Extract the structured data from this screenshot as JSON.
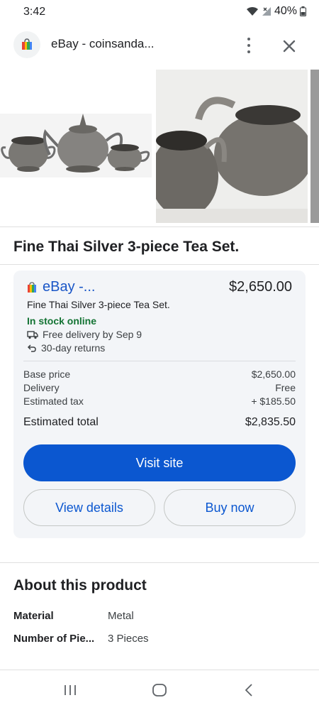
{
  "status_bar": {
    "time": "3:42",
    "battery": "40%"
  },
  "browser": {
    "title": "eBay - coinsanda..."
  },
  "product": {
    "title": "Fine Thai Silver 3-piece Tea Set."
  },
  "offer": {
    "seller": "eBay -...",
    "price": "$2,650.00",
    "description": "Fine Thai Silver 3-piece Tea Set.",
    "stock": "In stock online",
    "delivery": "Free delivery by Sep 9",
    "returns": "30-day returns",
    "breakdown": {
      "base_label": "Base price",
      "base_value": "$2,650.00",
      "delivery_label": "Delivery",
      "delivery_value": "Free",
      "tax_label": "Estimated tax",
      "tax_value": "+ $185.50",
      "total_label": "Estimated total",
      "total_value": "$2,835.50"
    },
    "visit_label": "Visit site",
    "details_label": "View details",
    "buy_label": "Buy now"
  },
  "about": {
    "title": "About this product",
    "specs": [
      {
        "key": "Material",
        "value": "Metal"
      },
      {
        "key": "Number of Pie...",
        "value": "3 Pieces"
      }
    ]
  },
  "colors": {
    "primary": "#0b57d0",
    "stock_green": "#137333",
    "card_bg": "#f3f5f8",
    "link": "#1a56c7"
  }
}
